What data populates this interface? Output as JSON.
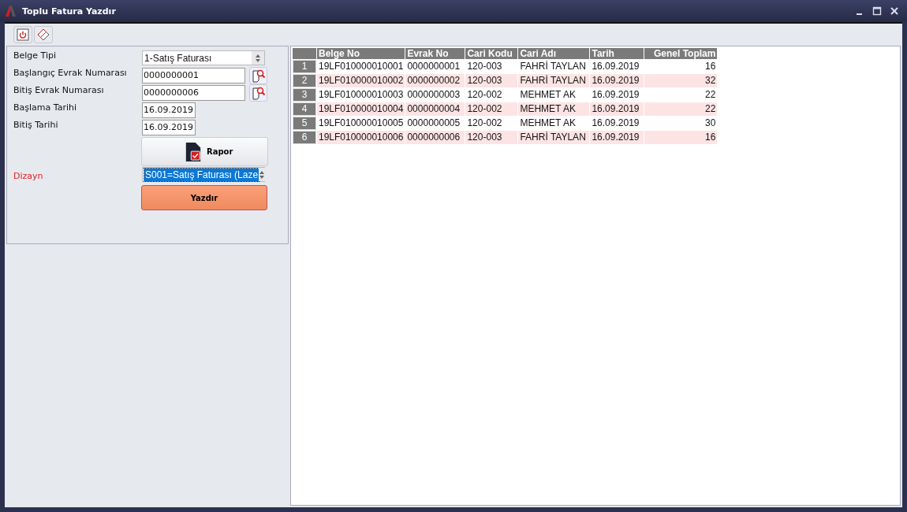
{
  "window": {
    "title": "Toplu Fatura Yazdır"
  },
  "toolbar": [
    {
      "kind": "power"
    },
    {
      "kind": "eraser"
    }
  ],
  "form": {
    "fields": [
      {
        "label": "Belge Tipi",
        "kind": "select",
        "value": "1-Satış Faturası"
      },
      {
        "label": "Başlangıç Evrak Numarası",
        "kind": "lookup",
        "value": "0000000001"
      },
      {
        "label": "Bitiş Evrak Numarası",
        "kind": "lookup",
        "value": "0000000006"
      },
      {
        "label": "Başlama Tarihi",
        "kind": "date",
        "value": "16.09.2019"
      },
      {
        "label": "Bitiş Tarihi",
        "kind": "date",
        "value": "16.09.2019"
      }
    ],
    "report_button": "Rapor",
    "design": {
      "label": "Dizayn",
      "required": true,
      "value": "S001=Satış Faturası (Laze",
      "value_selected": true
    },
    "print_button": "Yazdır"
  },
  "table": {
    "columns": [
      {
        "label": "Belge No",
        "numeric": false
      },
      {
        "label": "Evrak No",
        "numeric": false
      },
      {
        "label": "Cari Kodu",
        "numeric": false
      },
      {
        "label": "Cari Adı",
        "numeric": false
      },
      {
        "label": "Tarih",
        "numeric": false
      },
      {
        "label": "Genel Toplam",
        "numeric": true
      }
    ],
    "rows": [
      {
        "number": "1",
        "cells": [
          "19LF010000010001",
          "0000000001",
          "120-003",
          "FAHRİ TAYLAN",
          "16.09.2019",
          "16"
        ]
      },
      {
        "number": "2",
        "cells": [
          "19LF010000010002",
          "0000000002",
          "120-003",
          "FAHRİ TAYLAN",
          "16.09.2019",
          "32"
        ]
      },
      {
        "number": "3",
        "cells": [
          "19LF010000010003",
          "0000000003",
          "120-002",
          "MEHMET AK",
          "16.09.2019",
          "22"
        ]
      },
      {
        "number": "4",
        "cells": [
          "19LF010000010004",
          "0000000004",
          "120-002",
          "MEHMET AK",
          "16.09.2019",
          "22"
        ]
      },
      {
        "number": "5",
        "cells": [
          "19LF010000010005",
          "0000000005",
          "120-002",
          "MEHMET AK",
          "16.09.2019",
          "30"
        ]
      },
      {
        "number": "6",
        "cells": [
          "19LF010000010006",
          "0000000006",
          "120-003",
          "FAHRİ TAYLAN",
          "16.09.2019",
          "16"
        ]
      }
    ]
  }
}
